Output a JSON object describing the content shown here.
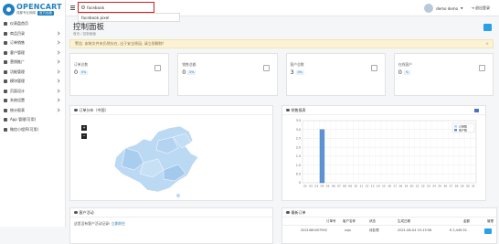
{
  "brand": {
    "name": "OPENCART",
    "subtitle": "成都专业网络",
    "badge": "官方出版"
  },
  "sidebar": {
    "items": [
      {
        "label": "仪表盘首页",
        "has_children": false
      },
      {
        "label": "商品目录",
        "has_children": true
      },
      {
        "label": "订单销售",
        "has_children": true
      },
      {
        "label": "客户管理",
        "has_children": true
      },
      {
        "label": "营销推广",
        "has_children": true
      },
      {
        "label": "功能管理",
        "has_children": true
      },
      {
        "label": "模块管理",
        "has_children": true
      },
      {
        "label": "页面设计",
        "has_children": true
      },
      {
        "label": "系统设置",
        "has_children": true
      },
      {
        "label": "统计报表",
        "has_children": true
      },
      {
        "label": "App 管理(可用)",
        "has_children": false
      },
      {
        "label": "微信小程序(可用)",
        "has_children": false
      }
    ]
  },
  "topbar": {
    "search_value": "facebook",
    "suggestion": "facebook pixel",
    "username": "demo demo",
    "logout": "退出登录"
  },
  "page": {
    "title": "控制面板",
    "breadcrumb": "首页 / 控制面板"
  },
  "alert": {
    "text": "警告: 安装文件夹仍然存在, 出于安全原因, 请立即删除!",
    "close": "×"
  },
  "stats": [
    {
      "label": "订单总数",
      "value": "0",
      "pct": "0%"
    },
    {
      "label": "销售总额",
      "value": "0",
      "pct": "0%"
    },
    {
      "label": "客户总数",
      "value": "3",
      "pct": "0%"
    },
    {
      "label": "在线客户",
      "value": "0",
      "pct": "%"
    }
  ],
  "map_panel": {
    "title": "订单分布（中国）",
    "zoom_in": "+",
    "zoom_out": "−"
  },
  "chart_panel": {
    "title": "销售报表"
  },
  "chart_data": {
    "type": "bar",
    "categories": [
      "01",
      "02",
      "03",
      "04",
      "05",
      "06",
      "07",
      "08",
      "09",
      "10",
      "11",
      "12",
      "13",
      "14",
      "15",
      "16",
      "17",
      "18",
      "19",
      "20",
      "21",
      "22",
      "23",
      "24",
      "25",
      "26",
      "27",
      "28",
      "29",
      "30",
      "31"
    ],
    "series": [
      {
        "name": "订单数",
        "color": "#b6d3f2",
        "values": [
          0,
          0,
          0,
          0,
          0,
          0,
          0,
          0,
          0,
          0,
          0,
          0,
          0,
          0,
          0,
          0,
          0,
          0,
          0,
          0,
          0,
          0,
          0,
          0,
          0,
          0,
          0,
          0,
          0,
          0,
          0
        ]
      },
      {
        "name": "客户数",
        "color": "#5e93d6",
        "values": [
          0,
          0,
          0,
          3,
          0,
          0,
          0,
          0,
          0,
          0,
          0,
          0,
          0,
          0,
          0,
          0,
          0,
          0,
          0,
          0,
          0,
          0,
          0,
          0,
          0,
          0,
          0,
          0,
          0,
          0,
          0
        ]
      }
    ],
    "ylim": [
      0,
      3.5
    ],
    "yticks": [
      "0",
      "0.5",
      "1.0",
      "1.5",
      "2.0",
      "2.5",
      "3.0",
      "3.5"
    ],
    "grid": true,
    "legend": "top-right"
  },
  "activity_panel": {
    "title": "客户活动",
    "text": "这里没有客户活动记录!",
    "link": "立即前往"
  },
  "orders_panel": {
    "title": "最新订单",
    "columns": [
      "订单号",
      "客户名称",
      "状态",
      "生成日期",
      "金额",
      "管理"
    ],
    "rows": [
      {
        "order_no": "2021080457992",
        "customer": "sujs",
        "status": "待处理",
        "date": "2021-08-04 15:13:56",
        "amount": "¥ 2,449.51"
      }
    ]
  }
}
